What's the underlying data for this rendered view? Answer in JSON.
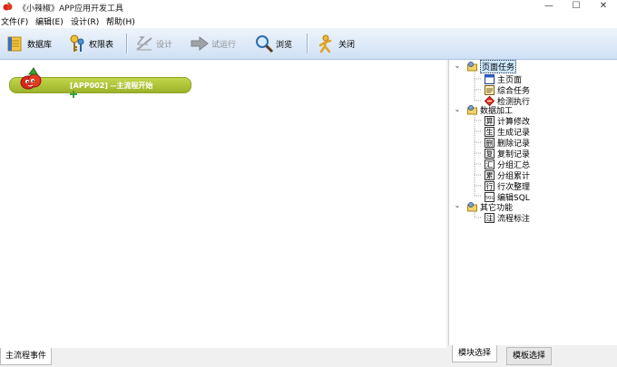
{
  "window": {
    "title": "《小辣椒》APP应用开发工具",
    "minimize_glyph": "—",
    "maximize_glyph": "☐",
    "close_glyph": "✕"
  },
  "menu": {
    "items": [
      {
        "label": "文件(F)"
      },
      {
        "label": "编辑(E)"
      },
      {
        "label": "设计(R)"
      },
      {
        "label": "帮助(H)"
      }
    ]
  },
  "toolbar": {
    "buttons": [
      {
        "label": "数据库",
        "icon": "database-icon",
        "enabled": true
      },
      {
        "label": "权限表",
        "icon": "keys-icon",
        "enabled": true
      },
      {
        "label": "设计",
        "icon": "design-icon",
        "enabled": false
      },
      {
        "label": "试运行",
        "icon": "arrow-right-icon",
        "enabled": false
      },
      {
        "label": "浏览",
        "icon": "magnifier-icon",
        "enabled": true
      },
      {
        "label": "关闭",
        "icon": "close-person-icon",
        "enabled": true
      }
    ]
  },
  "canvas": {
    "flow_node": {
      "label": "[APP002] --主流程开始"
    }
  },
  "bottom_tabs": [
    {
      "label": "主流程事件",
      "active": true
    }
  ],
  "tree": {
    "groups": [
      {
        "label": "页面任务",
        "expanded": true,
        "selected": true,
        "items": [
          {
            "label": "主页面",
            "icon": "page-icon"
          },
          {
            "label": "综合任务",
            "icon": "task-icon"
          },
          {
            "label": "检测执行",
            "icon": "diamond-icon"
          }
        ]
      },
      {
        "label": "数据加工",
        "expanded": true,
        "selected": false,
        "items": [
          {
            "label": "计算修改",
            "icon": "calc-icon",
            "glyph": "算"
          },
          {
            "label": "生成记录",
            "icon": "generate-icon",
            "glyph": "生"
          },
          {
            "label": "删除记录",
            "icon": "delete-icon",
            "glyph": "删"
          },
          {
            "label": "复制记录",
            "icon": "copy-icon",
            "glyph": "复"
          },
          {
            "label": "分组汇总",
            "icon": "group-sum-icon",
            "glyph": "汇"
          },
          {
            "label": "分组累计",
            "icon": "group-acc-icon",
            "glyph": "累"
          },
          {
            "label": "行次整理",
            "icon": "rows-icon",
            "glyph": "行"
          },
          {
            "label": "编辑SQL",
            "icon": "sql-icon",
            "glyph": "SQL"
          }
        ]
      },
      {
        "label": "其它功能",
        "expanded": true,
        "selected": false,
        "items": [
          {
            "label": "流程标注",
            "icon": "annotation-icon",
            "glyph": "注"
          }
        ]
      }
    ]
  },
  "right_tabs": [
    {
      "label": "模块选择",
      "active": true
    },
    {
      "label": "模板选择",
      "active": false
    }
  ],
  "colors": {
    "flow_node": "#a9bf33",
    "toolbar": "#cfe1f5",
    "selection": "#cde8ff"
  }
}
